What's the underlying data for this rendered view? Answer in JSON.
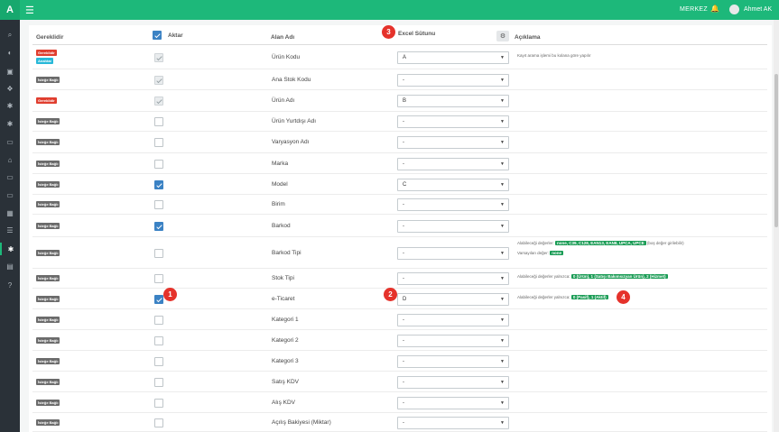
{
  "app": {
    "logo_letter": "A",
    "branch": "MERKEZ",
    "user": "Ahmet AK"
  },
  "icons": {
    "menu": "hamburger-icon",
    "bell": "bell-icon",
    "sidebar": [
      "search-icon",
      "dashboard-icon",
      "book-icon",
      "boxes-icon",
      "settings-icon",
      "settings-icon",
      "payment-icon",
      "bank-icon",
      "payment-icon",
      "payment-icon",
      "calendar-icon",
      "list-icon",
      "gear-active-icon",
      "document-icon",
      "help-icon"
    ]
  },
  "table": {
    "headers": {
      "required": "Gereklidir",
      "active": "Aktar",
      "field": "Alan Adı",
      "excel": "Excel Sütunu",
      "desc": "Açıklama"
    },
    "rows": [
      {
        "badges": [
          "Gereklidir",
          "Anahtar"
        ],
        "badge_types": [
          "req",
          "key"
        ],
        "active": "disabled",
        "field": "Ürün Kodu",
        "excel": "A",
        "desc": "Kayıt arama işlemi bu kolana göre yapılır"
      },
      {
        "badges": [
          "İsteğe Bağlı"
        ],
        "badge_types": [
          "opt"
        ],
        "active": "disabled",
        "field": "Ana Stok Kodu",
        "excel": "-",
        "desc": ""
      },
      {
        "badges": [
          "Gereklidir"
        ],
        "badge_types": [
          "req"
        ],
        "active": "disabled",
        "field": "Ürün Adı",
        "excel": "B",
        "desc": ""
      },
      {
        "badges": [
          "İsteğe Bağlı"
        ],
        "badge_types": [
          "opt"
        ],
        "active": "off",
        "field": "Ürün Yurtdışı Adı",
        "excel": "-",
        "desc": ""
      },
      {
        "badges": [
          "İsteğe Bağlı"
        ],
        "badge_types": [
          "opt"
        ],
        "active": "off",
        "field": "Varyasyon Adı",
        "excel": "-",
        "desc": ""
      },
      {
        "badges": [
          "İsteğe Bağlı"
        ],
        "badge_types": [
          "opt"
        ],
        "active": "off",
        "field": "Marka",
        "excel": "-",
        "desc": ""
      },
      {
        "badges": [
          "İsteğe Bağlı"
        ],
        "badge_types": [
          "opt"
        ],
        "active": "on",
        "field": "Model",
        "excel": "C",
        "desc": ""
      },
      {
        "badges": [
          "İsteğe Bağlı"
        ],
        "badge_types": [
          "opt"
        ],
        "active": "off",
        "field": "Birim",
        "excel": "-",
        "desc": ""
      },
      {
        "badges": [
          "İsteğe Bağlı"
        ],
        "badge_types": [
          "opt"
        ],
        "active": "on",
        "field": "Barkod",
        "excel": "-",
        "desc": ""
      },
      {
        "badges": [
          "İsteğe Bağlı"
        ],
        "badge_types": [
          "opt"
        ],
        "active": "off",
        "field": "Barkod Tipi",
        "excel": "-",
        "desc": ""
      },
      {
        "badges": [
          "İsteğe Bağlı"
        ],
        "badge_types": [
          "opt"
        ],
        "active": "off",
        "field": "Stok Tipi",
        "excel": "-",
        "desc": ""
      },
      {
        "badges": [
          "İsteğe Bağlı"
        ],
        "badge_types": [
          "opt"
        ],
        "active": "on",
        "field": "e-Ticaret",
        "excel": "D",
        "desc": ""
      },
      {
        "badges": [
          "İsteğe Bağlı"
        ],
        "badge_types": [
          "opt"
        ],
        "active": "off",
        "field": "Kategori 1",
        "excel": "-",
        "desc": ""
      },
      {
        "badges": [
          "İsteğe Bağlı"
        ],
        "badge_types": [
          "opt"
        ],
        "active": "off",
        "field": "Kategori 2",
        "excel": "-",
        "desc": ""
      },
      {
        "badges": [
          "İsteğe Bağlı"
        ],
        "badge_types": [
          "opt"
        ],
        "active": "off",
        "field": "Kategori 3",
        "excel": "-",
        "desc": ""
      },
      {
        "badges": [
          "İsteğe Bağlı"
        ],
        "badge_types": [
          "opt"
        ],
        "active": "off",
        "field": "Satış KDV",
        "excel": "-",
        "desc": ""
      },
      {
        "badges": [
          "İsteğe Bağlı"
        ],
        "badge_types": [
          "opt"
        ],
        "active": "off",
        "field": "Alış KDV",
        "excel": "-",
        "desc": ""
      },
      {
        "badges": [
          "İsteğe Bağlı"
        ],
        "badge_types": [
          "opt"
        ],
        "active": "off",
        "field": "Açılış Bakiyesi (Miktar)",
        "excel": "-",
        "desc": ""
      }
    ],
    "barkod_tipi_desc": {
      "prefix": "Alabileceği değerler:",
      "tag": "none, C39, C128, EAN13, EAN8, UPCA, UPCE",
      "suffix": "(boş değer girilebilir)",
      "line2_prefix": "Varsayılan değer:",
      "line2_tag": "none"
    },
    "stok_tipi_desc": {
      "prefix": "Alabileceği değerler yalnızca:",
      "tag": "0 (Ürün), 1 (Satışı Bakımsızyan Ürün), 2 (Hizmet)"
    },
    "eticaret_desc": {
      "prefix": "Alabileceği değerler yalnızca:",
      "tag": "0 (Pasif), 1 (Aktif)"
    }
  },
  "markers": [
    "1",
    "2",
    "3",
    "4"
  ]
}
